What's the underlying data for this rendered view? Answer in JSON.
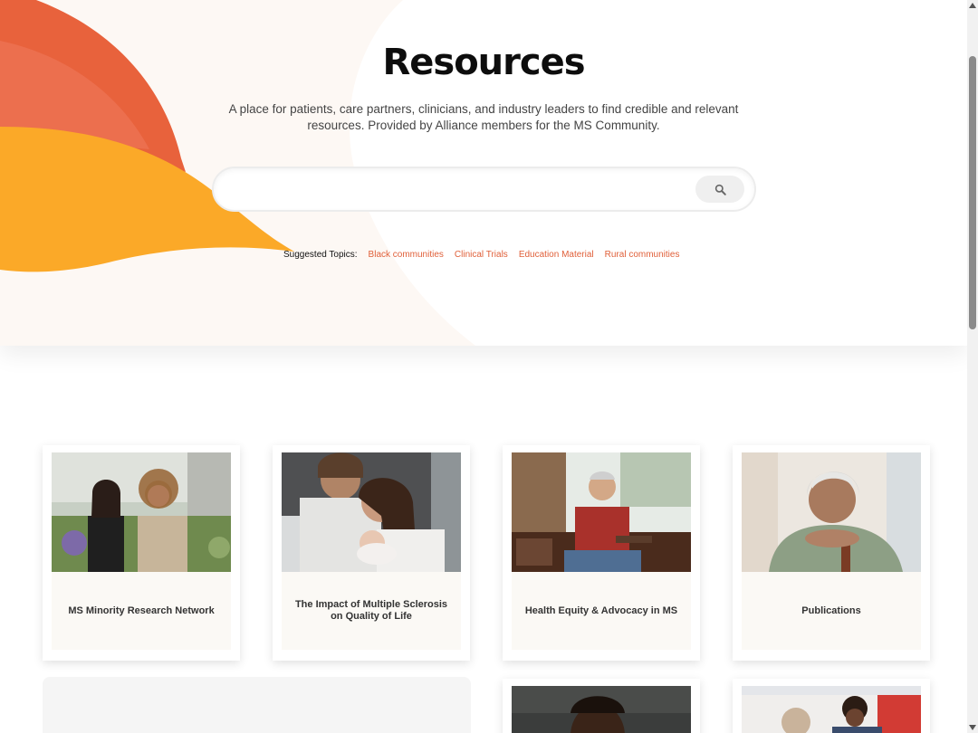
{
  "hero": {
    "title": "Resources",
    "subtitle": "A place for patients, care partners, clinicians, and industry leaders to find credible and relevant resources. Provided by Alliance members for the MS Community."
  },
  "search": {
    "value": "",
    "placeholder": "",
    "button_icon": "search-icon"
  },
  "topics": {
    "label": "Suggested Topics:",
    "items": [
      "Black communities",
      "Clinical Trials",
      "Education Material",
      "Rural communities"
    ]
  },
  "cards": [
    {
      "title": "MS Minority Research Network",
      "image": "two-women-outdoors-photo"
    },
    {
      "title": "The Impact of Multiple Sclerosis on Quality of Life",
      "image": "parents-with-baby-photo"
    },
    {
      "title": "Health Equity & Advocacy in MS",
      "image": "man-seated-red-shirt-photo"
    },
    {
      "title": "Publications",
      "image": "older-woman-with-cane-photo"
    }
  ],
  "colors": {
    "accent_orange": "#e0603a",
    "wave_red": "#e8623c",
    "wave_yellow": "#fba928",
    "card_body": "#fbf9f5"
  }
}
